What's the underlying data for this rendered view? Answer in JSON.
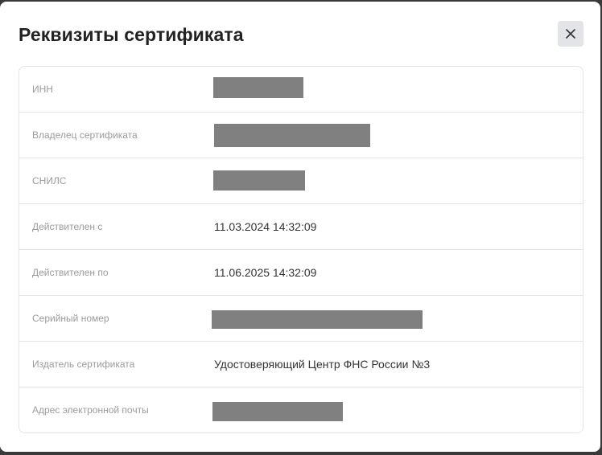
{
  "dialog": {
    "title": "Реквизиты сертификата",
    "close_icon": "close-icon"
  },
  "rows": [
    {
      "label": "ИНН",
      "value": null,
      "redacted": true
    },
    {
      "label": "Владелец сертификата",
      "value": null,
      "redacted": true
    },
    {
      "label": "СНИЛС",
      "value": null,
      "redacted": true
    },
    {
      "label": "Действителен с",
      "value": "11.03.2024 14:32:09",
      "redacted": false
    },
    {
      "label": "Действителен по",
      "value": "11.06.2025 14:32:09",
      "redacted": false
    },
    {
      "label": "Серийный номер",
      "value": null,
      "redacted": true
    },
    {
      "label": "Издатель сертификата",
      "value": "Удостоверяющий Центр ФНС России №3",
      "redacted": false
    },
    {
      "label": "Адрес электронной почты",
      "value": null,
      "redacted": true
    }
  ],
  "colors": {
    "redaction": "#808080",
    "label": "#9b9b9b",
    "value": "#333333"
  }
}
